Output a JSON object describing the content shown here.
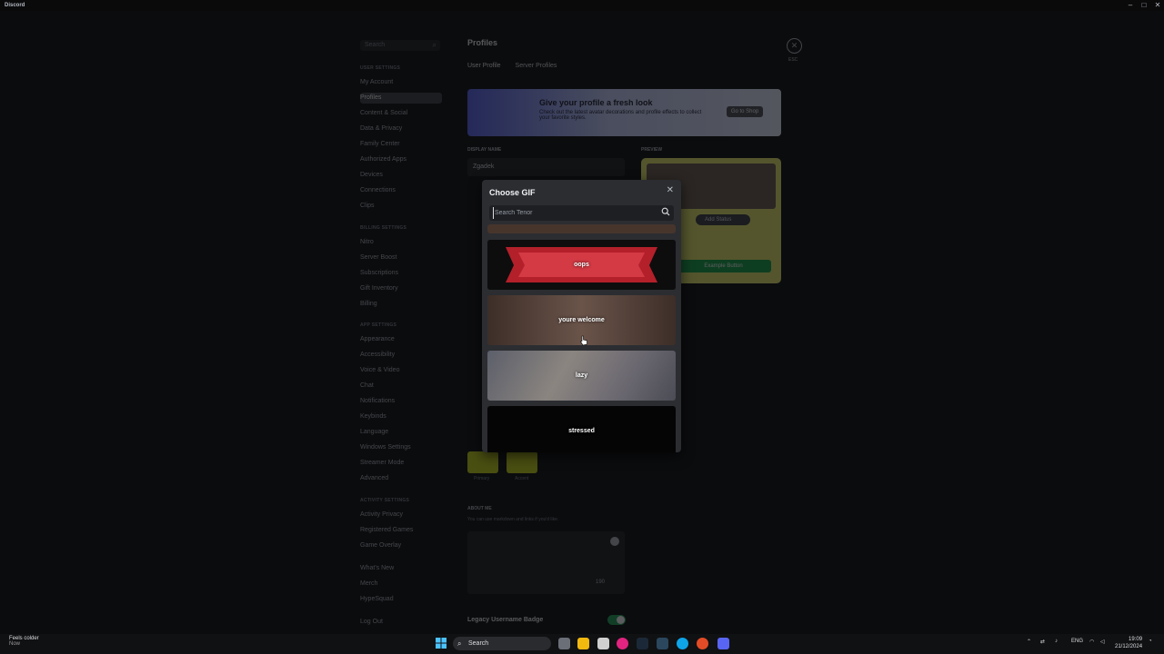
{
  "window": {
    "title": "Discord"
  },
  "settings": {
    "search_placeholder": "Search",
    "sections": {
      "user_settings": "USER SETTINGS",
      "billing_settings": "BILLING SETTINGS",
      "app_settings": "APP SETTINGS",
      "activity_settings": "ACTIVITY SETTINGS"
    },
    "user_items": [
      "My Account",
      "Profiles",
      "Content & Social",
      "Data & Privacy",
      "Family Center",
      "Authorized Apps",
      "Devices",
      "Connections",
      "Clips"
    ],
    "billing_items": [
      "Nitro",
      "Server Boost",
      "Subscriptions",
      "Gift Inventory",
      "Billing"
    ],
    "app_items": [
      "Appearance",
      "Accessibility",
      "Voice & Video",
      "Chat",
      "Notifications",
      "Keybinds",
      "Language",
      "Windows Settings",
      "Streamer Mode",
      "Advanced"
    ],
    "activity_items": [
      "Activity Privacy",
      "Registered Games",
      "Game Overlay"
    ],
    "misc_items": [
      "What's New",
      "Merch",
      "HypeSquad"
    ],
    "logout": "Log Out",
    "page_title": "Profiles",
    "tabs": [
      "User Profile",
      "Server Profiles"
    ],
    "banner": {
      "title": "Give your profile a fresh look",
      "subtitle": "Check out the latest avatar decorations and profile effects to collect your favorite styles.",
      "button": "Go to Shop"
    },
    "display_name_label": "DISPLAY NAME",
    "display_name_value": "Zgadek",
    "preview_label": "PREVIEW",
    "add_status": "Add Status",
    "example_button": "Example Button",
    "swatch_primary": "Primary",
    "swatch_accent": "Accent",
    "about_me_label": "ABOUT ME",
    "about_me_hint": "You can use markdown and links if you'd like.",
    "about_count": "190",
    "legacy_badge": "Legacy Username Badge",
    "esc": "ESC"
  },
  "gif_picker": {
    "title": "Choose GIF",
    "search_placeholder": "Search Tenor",
    "items": [
      "oops",
      "youre welcome",
      "lazy",
      "stressed"
    ]
  },
  "taskbar": {
    "weather": "Feels colder",
    "weather_sub": "Now",
    "search": "Search",
    "lang": "ENG",
    "time": "19:09",
    "date": "21/12/2024"
  },
  "colors": {
    "accent": "#5865f2",
    "preview_bg": "#e7ea6e",
    "toggle_on": "#23a55a"
  }
}
